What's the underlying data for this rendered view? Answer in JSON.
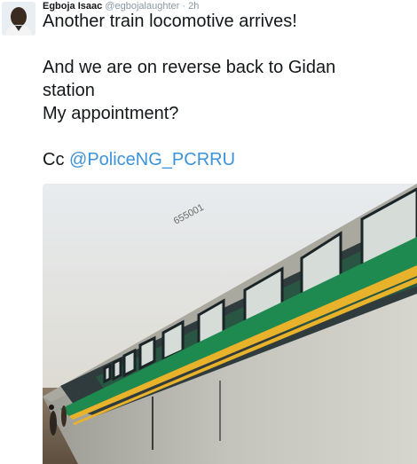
{
  "tweet": {
    "author_name": "Egboja Isaac",
    "author_handle": "@egbojalaughter",
    "separator": "·",
    "time": "2h",
    "lines": {
      "line1": "Another train locomotive arrives!",
      "line2": "And we are on reverse back to Gidan",
      "line3": "station",
      "line4": "My appointment?",
      "cc_prefix": "Cc",
      "mention": "@PoliceNG_PCRRU"
    },
    "photo": {
      "train_number": "655001"
    }
  },
  "colors": {
    "mention": "#3b94d9",
    "meta": "#8899a6",
    "train_green": "#1e8a4f",
    "train_yellow": "#e8b22a",
    "train_body": "#cfcfc6"
  }
}
